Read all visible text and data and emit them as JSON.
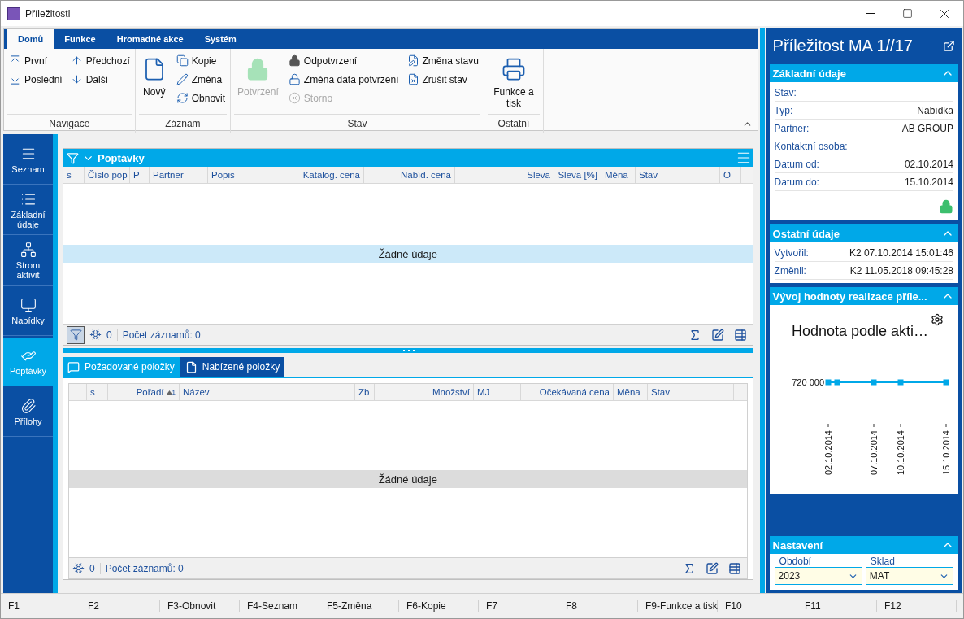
{
  "window": {
    "title": "Příležitosti"
  },
  "ribbon": {
    "tabs": [
      {
        "label": "Domů",
        "selected": true
      },
      {
        "label": "Funkce",
        "selected": false
      },
      {
        "label": "Hromadné akce",
        "selected": false
      },
      {
        "label": "Systém",
        "selected": false
      }
    ],
    "groups": [
      {
        "label": "Navigace",
        "columns": [
          {
            "kind": "small",
            "items": [
              {
                "label": "První",
                "disabled": false
              },
              {
                "label": "Poslední",
                "disabled": false
              }
            ]
          },
          {
            "kind": "small",
            "items": [
              {
                "label": "Předchozí",
                "disabled": false
              },
              {
                "label": "Další",
                "disabled": false
              }
            ]
          }
        ]
      },
      {
        "label": "Záznam",
        "columns": [
          {
            "kind": "large",
            "items": [
              {
                "label": "Nový",
                "disabled": false
              }
            ]
          },
          {
            "kind": "small",
            "items": [
              {
                "label": "Kopie",
                "disabled": false
              },
              {
                "label": "Změna",
                "disabled": false
              },
              {
                "label": "Obnovit",
                "disabled": false
              }
            ]
          }
        ]
      },
      {
        "label": "Stav",
        "columns": [
          {
            "kind": "large",
            "items": [
              {
                "label": "Potvrzení",
                "disabled": true
              }
            ]
          },
          {
            "kind": "small",
            "items": [
              {
                "label": "Odpotvrzení",
                "disabled": false
              },
              {
                "label": "Změna data potvrzení",
                "disabled": false
              },
              {
                "label": "Storno",
                "disabled": true
              }
            ]
          },
          {
            "kind": "small",
            "items": [
              {
                "label": "Změna stavu",
                "disabled": false
              },
              {
                "label": "Zrušit stav",
                "disabled": false
              }
            ]
          }
        ]
      },
      {
        "label": "Ostatní",
        "columns": [
          {
            "kind": "large",
            "items": [
              {
                "label": "Funkce a tisk",
                "disabled": false
              }
            ]
          }
        ]
      }
    ]
  },
  "sidebar": {
    "items": [
      {
        "label": "Seznam",
        "selected": false
      },
      {
        "label": "Základní údaje",
        "selected": false
      },
      {
        "label": "Strom aktivit",
        "selected": false
      },
      {
        "label": "Nabídky",
        "selected": false
      },
      {
        "label": "Poptávky",
        "selected": true
      },
      {
        "label": "Přílohy",
        "selected": false
      }
    ]
  },
  "requests_grid": {
    "title": "Poptávky",
    "columns": [
      "s",
      "Číslo pop",
      "P",
      "Partner",
      "Popis",
      "Katalog. cena",
      "Nabíd. cena",
      "Sleva",
      "Sleva [%]",
      "Měna",
      "Stav",
      "O"
    ],
    "empty_text": "Žádné údaje",
    "filter_count": "0",
    "record_count": "Počet záznamů: 0"
  },
  "item_tabs": [
    {
      "label": "Požadované položky",
      "selected": true
    },
    {
      "label": "Nabízené položky",
      "selected": false
    }
  ],
  "items_grid": {
    "columns": [
      "s",
      "Pořadí",
      "Název",
      "Zb",
      "Množství",
      "MJ",
      "Očekávaná cena",
      "Měna",
      "Stav"
    ],
    "sort_mark": "1",
    "empty_text": "Žádné údaje",
    "filter_count": "0",
    "record_count": "Počet záznamů: 0"
  },
  "detail": {
    "title": "Příležitost MA 1//17",
    "basic": {
      "title": "Základní údaje",
      "rows": [
        {
          "label": "Stav:",
          "value": ""
        },
        {
          "label": "Typ:",
          "value": "Nabídka"
        },
        {
          "label": "Partner:",
          "value": "AB GROUP"
        },
        {
          "label": "Kontaktní osoba:",
          "value": ""
        },
        {
          "label": "Datum od:",
          "value": "02.10.2014"
        },
        {
          "label": "Datum do:",
          "value": "15.10.2014"
        }
      ]
    },
    "other": {
      "title": "Ostatní údaje",
      "rows": [
        {
          "label": "Vytvořil:",
          "value": "K2 07.10.2014 15:01:46"
        },
        {
          "label": "Změnil:",
          "value": "K2 11.05.2018 09:45:28"
        }
      ]
    },
    "chart_panel": {
      "title": "Vývoj hodnoty realizace příle...",
      "chart_title": "Hodnota podle akti…",
      "value_label": "720 000",
      "date_labels": [
        "02.10.2014",
        "07.10.2014",
        "10.10.2014",
        "15.10.2014"
      ]
    },
    "settings": {
      "title": "Nastavení",
      "fields": [
        {
          "label": "Období",
          "value": "2023"
        },
        {
          "label": "Sklad",
          "value": "MAT"
        }
      ]
    }
  },
  "status_bar": [
    "F1",
    "F2",
    "F3-Obnovit",
    "F4-Seznam",
    "F5-Změna",
    "F6-Kopie",
    "F7",
    "F8",
    "F9-Funkce a tisk",
    "F10",
    "F11",
    "F12"
  ]
}
